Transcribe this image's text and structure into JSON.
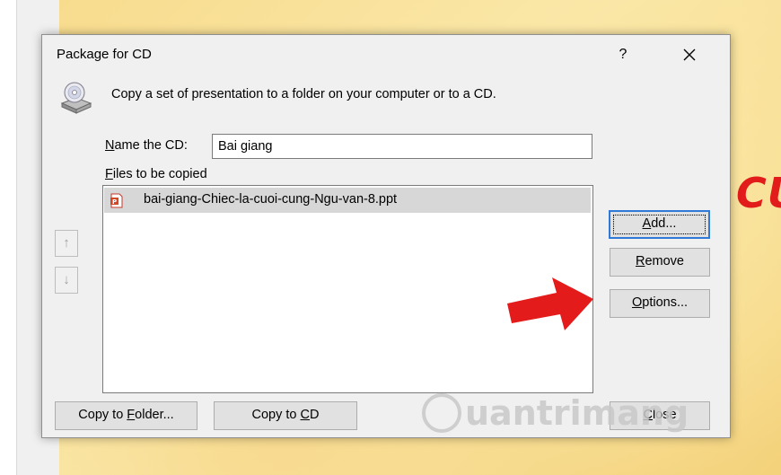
{
  "background": {
    "slide_text": "CU",
    "watermark_text": "uantrimang"
  },
  "dialog": {
    "title": "Package for CD",
    "help_label": "?",
    "description": "Copy a set of presentation to a folder on your computer or to a CD.",
    "name_label_prefix": "N",
    "name_label_rest": "ame the CD:",
    "name_value": "Bai giang",
    "files_label_prefix": "F",
    "files_label_rest": "iles to be copied",
    "files": [
      {
        "name": "bai-giang-Chiec-la-cuoi-cung-Ngu-van-8.ppt",
        "selected": true
      }
    ],
    "move_up_label": "↑",
    "move_down_label": "↓",
    "buttons": {
      "add": {
        "u": "A",
        "rest": "dd..."
      },
      "remove": {
        "u": "R",
        "rest": "emove"
      },
      "options": {
        "u": "O",
        "rest": "ptions..."
      },
      "copy_folder": {
        "pre": "Copy to ",
        "u": "F",
        "rest": "older..."
      },
      "copy_cd": {
        "pre": "Copy to ",
        "u": "C",
        "rest": "D"
      },
      "close": {
        "u": "C",
        "rest": "lose"
      }
    }
  },
  "colors": {
    "accent": "#2f7ad8",
    "annotation_arrow": "#e31b1b"
  }
}
